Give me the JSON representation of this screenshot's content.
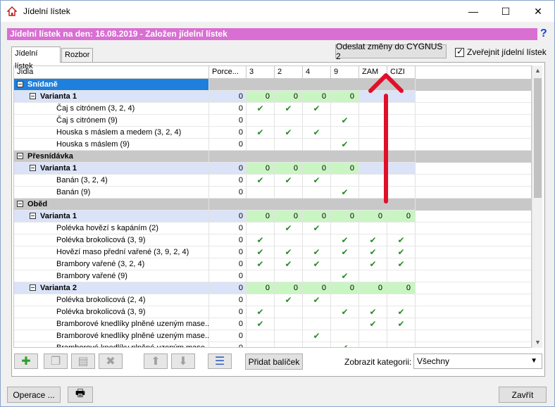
{
  "window": {
    "title": "Jídelní lístek",
    "min": "—",
    "max": "☐",
    "close": "✕"
  },
  "header": {
    "text": "Jídelní lístek na den: 16.08.2019 - Založen jídelní lístek",
    "help": "?"
  },
  "tabs": [
    {
      "label": "Jídelní lístek"
    },
    {
      "label": "Rozbor"
    }
  ],
  "toolbar_top": {
    "send_label": "Odeslat změny do CYGNUS 2",
    "publish_label": "Zveřejnit jídelní lístek"
  },
  "grid": {
    "headers": [
      "Jídla",
      "Porce...",
      "3",
      "2",
      "4",
      "9",
      "ZAM",
      "CIZI"
    ],
    "rows": [
      {
        "type": "cat",
        "name": "Snídaně",
        "selected": true
      },
      {
        "type": "var",
        "name": "Varianta 1",
        "porce": "0",
        "cols": [
          "0",
          "0",
          "0",
          "0",
          "",
          ""
        ]
      },
      {
        "type": "item",
        "name": "Čaj s citrónem (3, 2, 4)",
        "porce": "0",
        "checks": [
          1,
          1,
          1,
          0,
          0,
          0
        ]
      },
      {
        "type": "item",
        "name": "Čaj s citrónem (9)",
        "porce": "0",
        "checks": [
          0,
          0,
          0,
          1,
          0,
          0
        ]
      },
      {
        "type": "item",
        "name": "Houska s máslem a medem (3, 2, 4)",
        "porce": "0",
        "checks": [
          1,
          1,
          1,
          0,
          0,
          0
        ]
      },
      {
        "type": "item",
        "name": "Houska s máslem (9)",
        "porce": "0",
        "checks": [
          0,
          0,
          0,
          1,
          0,
          0
        ]
      },
      {
        "type": "cat",
        "name": "Přesnídávka"
      },
      {
        "type": "var",
        "name": "Varianta 1",
        "porce": "0",
        "cols": [
          "0",
          "0",
          "0",
          "0",
          "",
          ""
        ]
      },
      {
        "type": "item",
        "name": "Banán (3, 2, 4)",
        "porce": "0",
        "checks": [
          1,
          1,
          1,
          0,
          0,
          0
        ]
      },
      {
        "type": "item",
        "name": "Banán (9)",
        "porce": "0",
        "checks": [
          0,
          0,
          0,
          1,
          0,
          0
        ]
      },
      {
        "type": "cat",
        "name": "Oběd"
      },
      {
        "type": "var",
        "name": "Varianta 1",
        "porce": "0",
        "cols": [
          "0",
          "0",
          "0",
          "0",
          "0",
          "0"
        ]
      },
      {
        "type": "item",
        "name": "Polévka hovězí s kapáním (2)",
        "porce": "0",
        "checks": [
          0,
          1,
          1,
          0,
          0,
          0
        ]
      },
      {
        "type": "item",
        "name": "Polévka brokolicová (3, 9)",
        "porce": "0",
        "checks": [
          1,
          0,
          0,
          1,
          1,
          1
        ]
      },
      {
        "type": "item",
        "name": "Hovězí maso přední vařené (3, 9, 2, 4)",
        "porce": "0",
        "checks": [
          1,
          1,
          1,
          1,
          1,
          1
        ]
      },
      {
        "type": "item",
        "name": "Brambory vařené (3, 2, 4)",
        "porce": "0",
        "checks": [
          1,
          1,
          1,
          0,
          1,
          1
        ]
      },
      {
        "type": "item",
        "name": "Brambory vařené (9)",
        "porce": "0",
        "checks": [
          0,
          0,
          0,
          1,
          0,
          0
        ]
      },
      {
        "type": "var",
        "name": "Varianta 2",
        "porce": "0",
        "cols": [
          "0",
          "0",
          "0",
          "0",
          "0",
          "0"
        ]
      },
      {
        "type": "item",
        "name": "Polévka brokolicová (2, 4)",
        "porce": "0",
        "checks": [
          0,
          1,
          1,
          0,
          0,
          0
        ]
      },
      {
        "type": "item",
        "name": "Polévka brokolicová (3, 9)",
        "porce": "0",
        "checks": [
          1,
          0,
          0,
          1,
          1,
          1
        ]
      },
      {
        "type": "item",
        "name": "Bramborové knedlíky plněné uzeným mase...",
        "porce": "0",
        "checks": [
          1,
          0,
          0,
          0,
          1,
          1
        ]
      },
      {
        "type": "item",
        "name": "Bramborové knedlíky plněné uzeným mase...",
        "porce": "0",
        "checks": [
          0,
          0,
          1,
          0,
          0,
          0
        ]
      },
      {
        "type": "item",
        "name": "Bramborové knedlíky plněné uzeným mase...",
        "porce": "0",
        "checks": [
          0,
          0,
          0,
          1,
          0,
          0
        ]
      }
    ]
  },
  "bottom": {
    "add_icon": "✚",
    "pridat_label": "Přidat balíček",
    "kategorie_label": "Zobrazit kategorii:",
    "kategorie_value": "Všechny",
    "operace_label": "Operace ...",
    "zavrit_label": "Zavřít"
  },
  "colors": {
    "header_pink": "#d96fd2",
    "category_gray": "#c8c8c8",
    "category_selected": "#1f7fdc",
    "variant_blue": "#dae3f7",
    "zero_green": "#c9f5c2",
    "check_green": "#2a8c2a",
    "arrow_red": "#e0102a"
  }
}
